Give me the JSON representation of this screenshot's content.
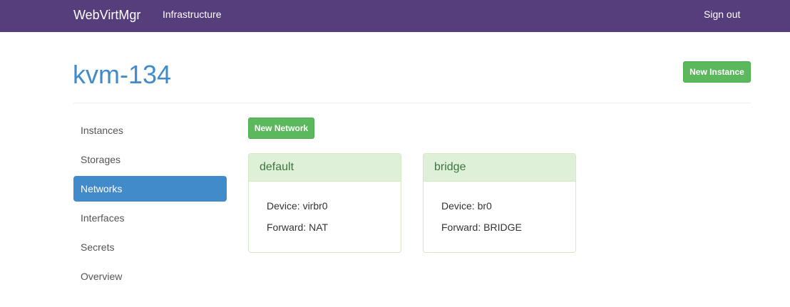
{
  "navbar": {
    "brand": "WebVirtMgr",
    "links": [
      {
        "label": "Infrastructure"
      }
    ],
    "sign_out": "Sign out"
  },
  "header": {
    "title": "kvm-134",
    "new_instance_button": "New Instance"
  },
  "sidebar": {
    "items": [
      {
        "label": "Instances",
        "active": false
      },
      {
        "label": "Storages",
        "active": false
      },
      {
        "label": "Networks",
        "active": true
      },
      {
        "label": "Interfaces",
        "active": false
      },
      {
        "label": "Secrets",
        "active": false
      },
      {
        "label": "Overview",
        "active": false
      }
    ]
  },
  "main": {
    "new_network_button": "New Network",
    "networks": [
      {
        "name": "default",
        "device": "Device: virbr0",
        "forward": "Forward: NAT"
      },
      {
        "name": "bridge",
        "device": "Device: br0",
        "forward": "Forward: BRIDGE"
      }
    ]
  },
  "colors": {
    "navbar": "#563d7c",
    "primary": "#428bca",
    "success": "#5cb85c",
    "panel_heading": "#dff0d8",
    "panel_title": "#3c763d"
  }
}
